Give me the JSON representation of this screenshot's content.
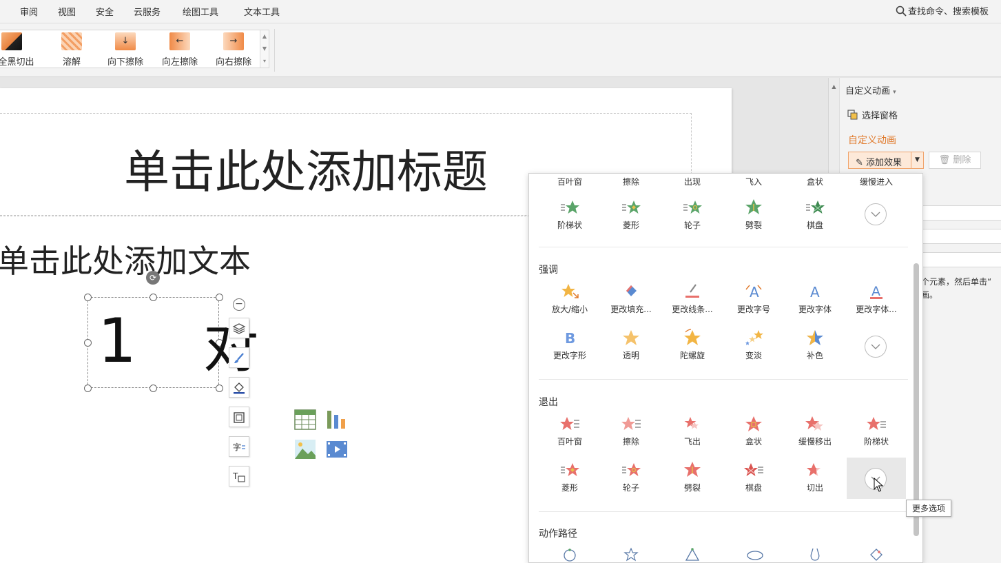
{
  "menu": {
    "items": [
      "审阅",
      "视图",
      "安全",
      "云服务",
      "绘图工具",
      "文本工具"
    ],
    "search_label": "查找命令、搜索模板"
  },
  "ribbon": {
    "gallery": [
      {
        "label": "从全黑切出",
        "icon": "fade-black-icon"
      },
      {
        "label": "溶解",
        "icon": "dissolve-icon"
      },
      {
        "label": "向下擦除",
        "icon": "wipe-down-icon"
      },
      {
        "label": "向左擦除",
        "icon": "wipe-left-icon"
      },
      {
        "label": "向右擦除",
        "icon": "wipe-right-icon"
      }
    ]
  },
  "slide": {
    "title_placeholder": "单击此处添加标题",
    "body_placeholder": "单击此处添加文本",
    "shape_text_1": "1",
    "shape_text_2": "对"
  },
  "taskpane": {
    "title": "自定义动画",
    "select_pane": "选择窗格",
    "section_label": "自定义动画",
    "add_effect": "添加效果",
    "delete": "删除",
    "hint": "个元素，然后单击“\n画。"
  },
  "dropdown": {
    "entrance_row1": [
      "百叶窗",
      "擦除",
      "出现",
      "飞入",
      "盒状",
      "缓慢进入"
    ],
    "entrance_row2": [
      "阶梯状",
      "菱形",
      "轮子",
      "劈裂",
      "棋盘"
    ],
    "emphasis_title": "强调",
    "emphasis_row1": [
      "放大/缩小",
      "更改填充...",
      "更改线条...",
      "更改字号",
      "更改字体",
      "更改字体..."
    ],
    "emphasis_row2": [
      "更改字形",
      "透明",
      "陀螺旋",
      "变淡",
      "补色"
    ],
    "exit_title": "退出",
    "exit_row1": [
      "百叶窗",
      "擦除",
      "飞出",
      "盒状",
      "缓慢移出",
      "阶梯状"
    ],
    "exit_row2": [
      "菱形",
      "轮子",
      "劈裂",
      "棋盘",
      "切出"
    ],
    "path_title": "动作路径"
  },
  "tooltip": "更多选项",
  "colors": {
    "accent_orange": "#e0792a",
    "entrance_green": "#5aa469",
    "exit_red": "#e8706b",
    "emphasis_gold": "#f2b544"
  }
}
